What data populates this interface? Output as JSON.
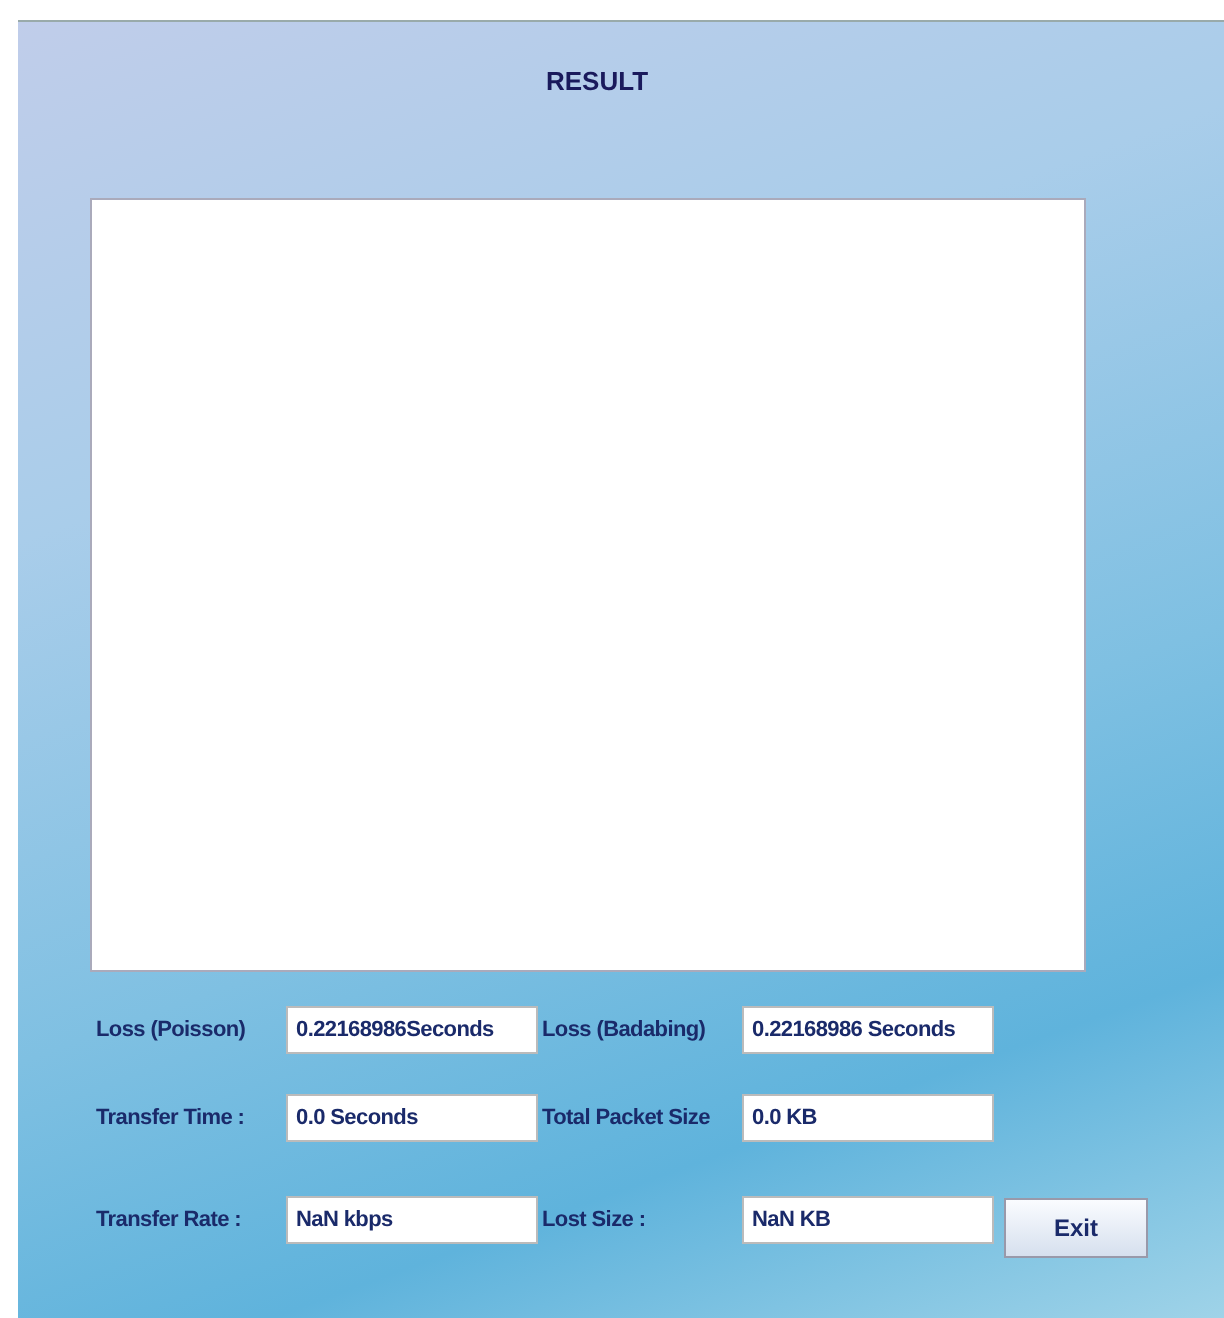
{
  "title": "RESULT",
  "fields": [
    {
      "label": "Loss (Poisson)",
      "value": "0.22168986Seconds"
    },
    {
      "label": "Loss (Badabing)",
      "value": "0.22168986 Seconds"
    },
    {
      "label": "Transfer Time :",
      "value": "0.0 Seconds"
    },
    {
      "label": "Total Packet Size",
      "value": "0.0 KB"
    },
    {
      "label": "Transfer Rate :",
      "value": "NaN kbps"
    },
    {
      "label": "Lost Size :",
      "value": "NaN KB"
    }
  ],
  "buttons": [
    "Exit"
  ]
}
